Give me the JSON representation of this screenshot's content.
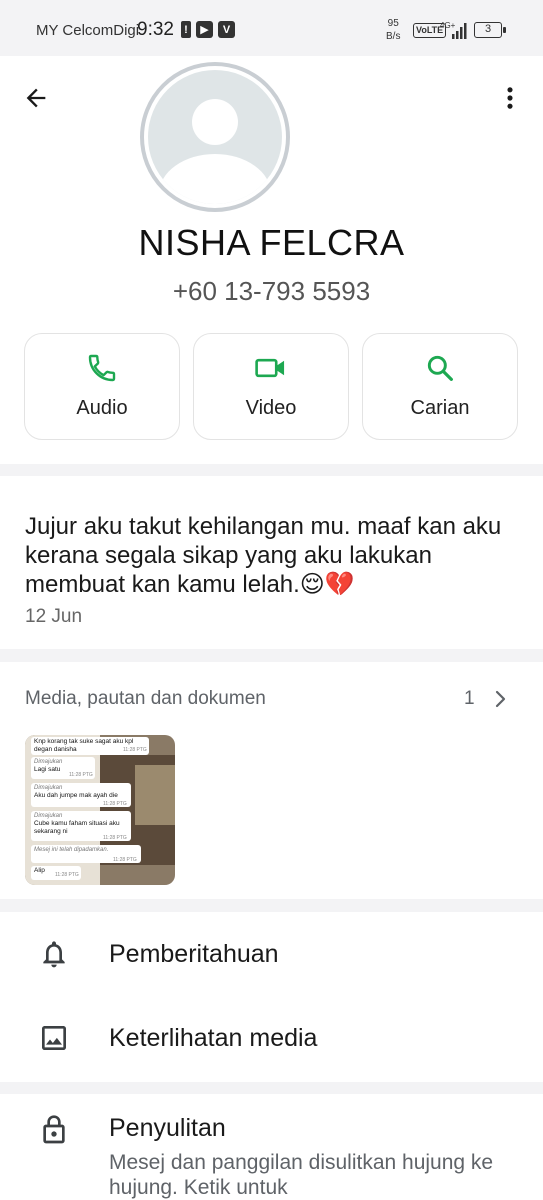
{
  "status_bar": {
    "carrier": "MY CelcomDigi",
    "time": "9:32",
    "speed_value": "95",
    "speed_unit": "B/s",
    "volte": "VoLTE",
    "network": "4G+",
    "battery": "3"
  },
  "contact": {
    "name": "NISHA FELCRA",
    "phone": "+60 13-793 5593"
  },
  "actions": [
    {
      "label": "Audio",
      "icon": "phone-icon"
    },
    {
      "label": "Video",
      "icon": "video-icon"
    },
    {
      "label": "Carian",
      "icon": "search-icon"
    }
  ],
  "about": {
    "text": "Jujur aku takut kehilangan mu. maaf kan aku kerana segala sikap yang aku lakukan membuat kan kamu lelah.😌💔",
    "date": "12 Jun"
  },
  "media": {
    "title": "Media, pautan dan dokumen",
    "count": "1",
    "thumbnail": {
      "messages": [
        {
          "text": "Knp korang tak suke sagat aku kpl degan danisha",
          "time": "11:28 PTG",
          "forwarded": ""
        },
        {
          "text": "Lagi satu",
          "time": "11:28 PTG",
          "forwarded": "Dimajukan"
        },
        {
          "text": "Aku dah jumpe mak ayah die",
          "time": "11:28 PTG",
          "forwarded": "Dimajukan"
        },
        {
          "text": "Cube kamu faham situasi aku sekarang ni",
          "time": "11:28 PTG",
          "forwarded": "Dimajukan"
        },
        {
          "text": "Mesej ini telah dipadamkan.",
          "time": "11:28 PTG",
          "forwarded": ""
        },
        {
          "text": "Alip",
          "time": "11:28 PTG",
          "forwarded": ""
        }
      ]
    }
  },
  "settings": {
    "notifications": "Pemberitahuan",
    "media_visibility": "Keterlihatan media"
  },
  "encryption": {
    "title": "Penyulitan",
    "subtitle": "Mesej dan panggilan disulitkan hujung ke hujung. Ketik untuk"
  },
  "colors": {
    "accent_green": "#1da851",
    "background": "#f3f3f5",
    "card": "#ffffff"
  }
}
